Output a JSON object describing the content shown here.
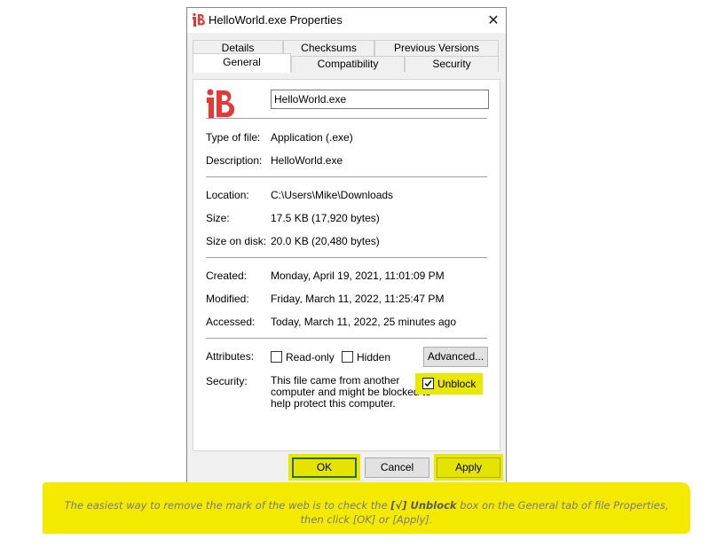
{
  "window": {
    "title": "HelloWorld.exe Properties",
    "close_glyph": "✕",
    "icon": "app-logo-icon",
    "brand_color": "#e53935"
  },
  "tabs": {
    "row1": [
      "Details",
      "Checksums",
      "Previous Versions"
    ],
    "row2": [
      "General",
      "Compatibility",
      "Security"
    ],
    "active": "General"
  },
  "general": {
    "filename": "HelloWorld.exe",
    "type_label": "Type of file:",
    "type_value": "Application (.exe)",
    "desc_label": "Description:",
    "desc_value": "HelloWorld.exe",
    "location_label": "Location:",
    "location_value": "C:\\Users\\Mike\\Downloads",
    "size_label": "Size:",
    "size_value": "17.5 KB (17,920 bytes)",
    "size_on_disk_label": "Size on disk:",
    "size_on_disk_value": "20.0 KB (20,480 bytes)",
    "created_label": "Created:",
    "created_value": "Monday, April 19, 2021, 11:01:09 PM",
    "modified_label": "Modified:",
    "modified_value": "Friday, March 11, 2022, 11:25:47 PM",
    "accessed_label": "Accessed:",
    "accessed_value": "Today, March 11, 2022, 25 minutes ago",
    "attributes_label": "Attributes:",
    "readonly_label": "Read-only",
    "hidden_label": "Hidden",
    "advanced_label": "Advanced...",
    "security_label": "Security:",
    "security_line1": "This file came from another",
    "security_line2": "computer and might be blocked to",
    "security_line3": "help protect this computer.",
    "unblock_label": "Unblock",
    "unblock_checked": true,
    "readonly_checked": false,
    "hidden_checked": false
  },
  "buttons": {
    "ok": "OK",
    "cancel": "Cancel",
    "apply": "Apply"
  },
  "highlight_color": "#e8e800",
  "caption": {
    "line1_a": "The easiest way to remove the mark of the web is to check the",
    "line1_bold": "[√] Unblock",
    "line1_b": "box on the General tab of file Properties,",
    "line2": "then click [OK] or [Apply]."
  }
}
